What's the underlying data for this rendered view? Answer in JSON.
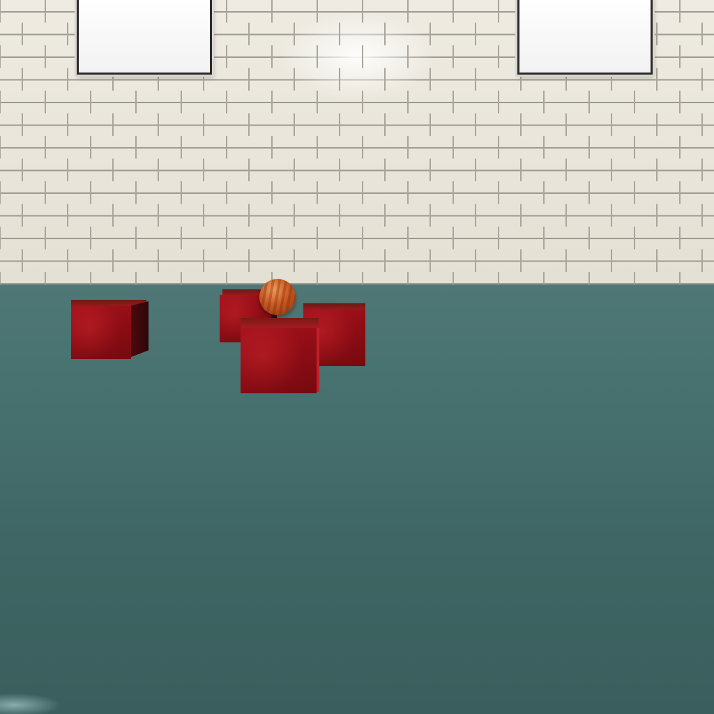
{
  "scene": {
    "wall_color": "#e9e5da",
    "floor_color": "#3f6563",
    "objects": [
      {
        "kind": "window",
        "name": "window-left"
      },
      {
        "kind": "window",
        "name": "window-right"
      },
      {
        "kind": "cube",
        "name": "cube-left",
        "color": "#9a0f18"
      },
      {
        "kind": "cube",
        "name": "cube-back-center",
        "color": "#9a0f18"
      },
      {
        "kind": "cube",
        "name": "cube-right",
        "color": "#9a0f18"
      },
      {
        "kind": "cube",
        "name": "cube-front-center",
        "color": "#9a0f18"
      },
      {
        "kind": "sphere",
        "name": "wooden-ball",
        "color": "#c85a22"
      }
    ]
  }
}
